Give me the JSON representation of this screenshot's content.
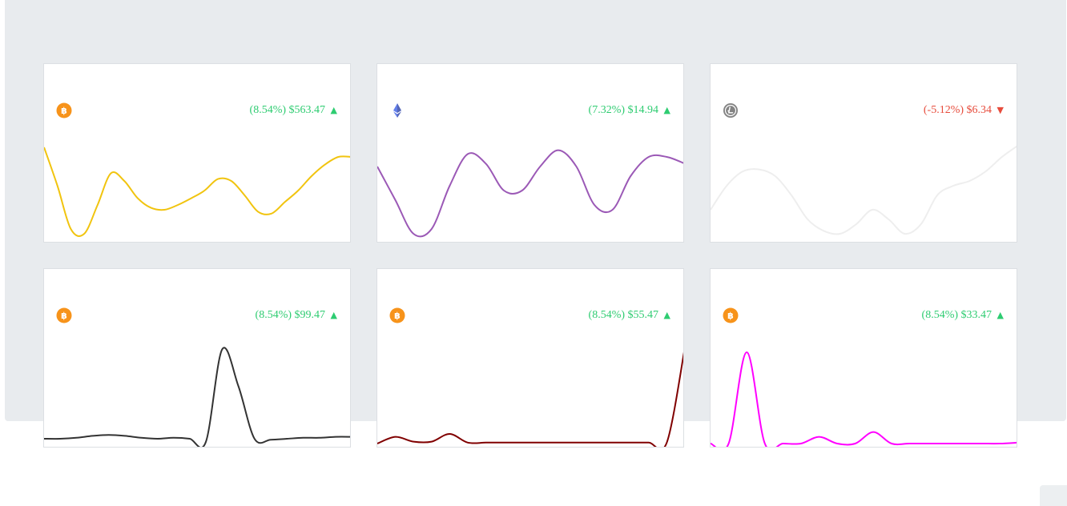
{
  "cards": [
    {
      "coin_icon": "bitcoin-icon",
      "icon_color": "#f7931a",
      "change": "(8.54%)",
      "price": "$563.47",
      "direction": "up",
      "arrow": "▲",
      "line_color": "#f1c40f",
      "trend": [
        0.95,
        0.55,
        0.1,
        0.05,
        0.35,
        0.68,
        0.6,
        0.42,
        0.32,
        0.3,
        0.35,
        0.42,
        0.5,
        0.62,
        0.6,
        0.45,
        0.28,
        0.26,
        0.38,
        0.5,
        0.65,
        0.77,
        0.85,
        0.85
      ]
    },
    {
      "coin_icon": "ethereum-icon",
      "icon_color": "#627eea",
      "change": "(7.32%)",
      "price": "$14.94",
      "direction": "up",
      "arrow": "▲",
      "line_color": "#9b59b6",
      "trend": [
        0.75,
        0.4,
        0.05,
        0.1,
        0.55,
        0.88,
        0.78,
        0.5,
        0.5,
        0.75,
        0.92,
        0.75,
        0.35,
        0.3,
        0.65,
        0.85,
        0.85,
        0.78
      ]
    },
    {
      "coin_icon": "litecoin-icon",
      "icon_color": "#838383",
      "change": "(-5.12%)",
      "price": "$6.34",
      "direction": "down",
      "arrow": "▼",
      "line_color": "#eeeeee",
      "trend": [
        0.3,
        0.55,
        0.7,
        0.72,
        0.65,
        0.45,
        0.2,
        0.08,
        0.05,
        0.15,
        0.3,
        0.2,
        0.05,
        0.15,
        0.45,
        0.55,
        0.6,
        0.7,
        0.85,
        0.97
      ]
    },
    {
      "coin_icon": "bitcoin-icon",
      "icon_color": "#f7931a",
      "change": "(8.54%)",
      "price": "$99.47",
      "direction": "up",
      "arrow": "▲",
      "line_color": "#333333",
      "trend": [
        0.05,
        0.05,
        0.06,
        0.08,
        0.09,
        0.08,
        0.06,
        0.05,
        0.06,
        0.05,
        0.02,
        0.98,
        0.6,
        0.05,
        0.04,
        0.05,
        0.06,
        0.06,
        0.07,
        0.07
      ]
    },
    {
      "coin_icon": "bitcoin-icon",
      "icon_color": "#f7931a",
      "change": "(8.54%)",
      "price": "$55.47",
      "direction": "up",
      "arrow": "▲",
      "line_color": "#800000",
      "trend": [
        0.0,
        0.07,
        0.02,
        0.02,
        0.1,
        0.01,
        0.01,
        0.01,
        0.01,
        0.01,
        0.01,
        0.01,
        0.01,
        0.01,
        0.01,
        0.01,
        0.01,
        1.0
      ]
    },
    {
      "coin_icon": "bitcoin-icon",
      "icon_color": "#f7931a",
      "change": "(8.54%)",
      "price": "$33.47",
      "direction": "up",
      "arrow": "▲",
      "line_color": "#ff00ff",
      "trend": [
        0.0,
        0.0,
        0.95,
        0.0,
        0.0,
        0.0,
        0.07,
        0.0,
        0.0,
        0.12,
        0.0,
        0.0,
        0.0,
        0.0,
        0.0,
        0.0,
        0.0,
        0.01
      ]
    }
  ]
}
